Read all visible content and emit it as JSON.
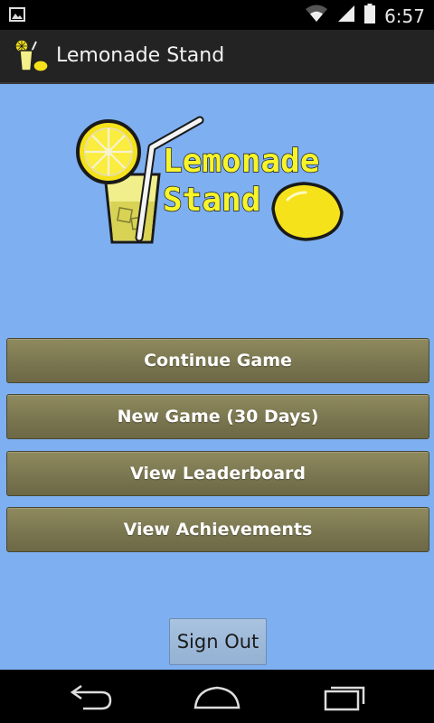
{
  "status_bar": {
    "time": "6:57",
    "icons": [
      "image-notification-icon",
      "wifi-icon",
      "signal-icon",
      "battery-icon"
    ]
  },
  "action_bar": {
    "title": "Lemonade Stand",
    "icon": "lemonade-glass-icon"
  },
  "logo": {
    "line1": "Lemonade",
    "line2": "Stand"
  },
  "menu": {
    "buttons": [
      {
        "label": "Continue Game"
      },
      {
        "label": "New Game (30 Days)"
      },
      {
        "label": "View Leaderboard"
      },
      {
        "label": "View Achievements"
      }
    ],
    "sign_out_label": "Sign Out"
  },
  "nav_bar": {
    "icons": [
      "back-icon",
      "home-icon",
      "recent-apps-icon"
    ]
  },
  "colors": {
    "background": "#7eaff0",
    "button": "#7a7650",
    "action_bar": "#232323",
    "logo_text": "#f7f52a"
  }
}
